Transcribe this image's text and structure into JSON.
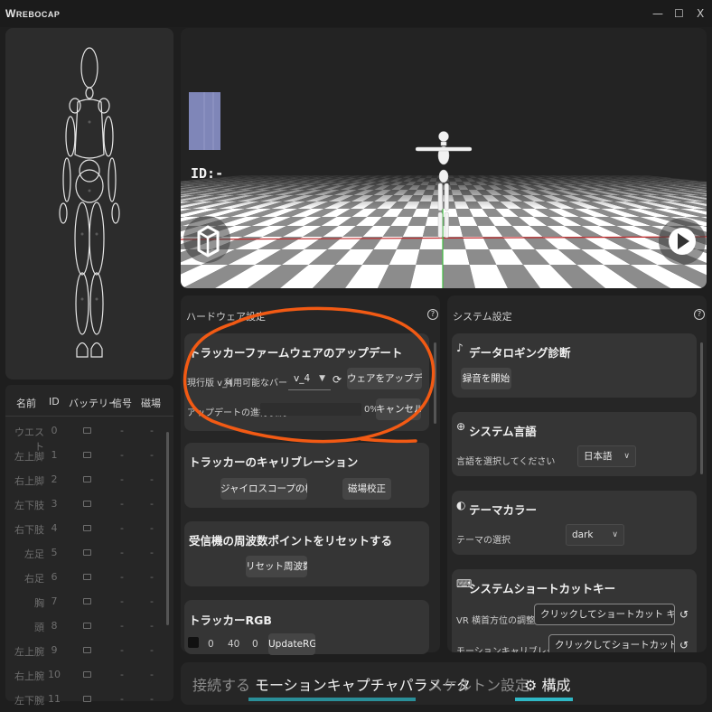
{
  "app": {
    "logo": "REBOCAP",
    "window_controls": {
      "minimize": "—",
      "maximize": "☐",
      "close": "X"
    }
  },
  "viewport": {
    "id_label": "ID:-"
  },
  "tracker_table": {
    "headers": [
      "名前",
      "ID",
      "バッテリー",
      "信号",
      "磁場"
    ],
    "rows": [
      {
        "name": "ウエスト",
        "id": "0",
        "signal": "-",
        "mag": "-"
      },
      {
        "name": "左上脚",
        "id": "1",
        "signal": "-",
        "mag": "-"
      },
      {
        "name": "右上脚",
        "id": "2",
        "signal": "-",
        "mag": "-"
      },
      {
        "name": "左下肢",
        "id": "3",
        "signal": "-",
        "mag": "-"
      },
      {
        "name": "右下肢",
        "id": "4",
        "signal": "-",
        "mag": "-"
      },
      {
        "name": "左足",
        "id": "5",
        "signal": "-",
        "mag": "-"
      },
      {
        "name": "右足",
        "id": "6",
        "signal": "-",
        "mag": "-"
      },
      {
        "name": "胸",
        "id": "7",
        "signal": "-",
        "mag": "-"
      },
      {
        "name": "頭",
        "id": "8",
        "signal": "-",
        "mag": "-"
      },
      {
        "name": "左上腕",
        "id": "9",
        "signal": "-",
        "mag": "-"
      },
      {
        "name": "右上腕",
        "id": "10",
        "signal": "-",
        "mag": "-"
      },
      {
        "name": "左下腕",
        "id": "11",
        "signal": "-",
        "mag": "-"
      }
    ]
  },
  "hardware": {
    "title": "ハードウェア設定",
    "firmware": {
      "title": "トラッカーファームウェアのアップデート",
      "current_label": "現行版 v_4",
      "available_label": "利用可能なバージョン",
      "version": "v_4",
      "update_button": "ウェアをアップデー",
      "progress_label": "アップデートの進行状況",
      "progress_value": "0%",
      "cancel_button": "キャンセル"
    },
    "calibration": {
      "title": "トラッカーのキャリブレーション",
      "gyro_button": "ジャイロスコープの校正",
      "mag_button": "磁場校正"
    },
    "frequency": {
      "title": "受信機の周波数ポイントをリセットする",
      "reset_button": "リセット周波数"
    },
    "rgb": {
      "title": "トラッカーRGB",
      "r": "0",
      "g": "40",
      "b": "0",
      "update_button": "UpdateRGB"
    }
  },
  "system": {
    "title": "システム設定",
    "logging": {
      "title": "データロギング診断",
      "start_button": "録音を開始"
    },
    "language": {
      "title": "システム言語",
      "label": "言語を選択してください",
      "value": "日本語"
    },
    "theme": {
      "title": "テーマカラー",
      "label": "テーマの選択",
      "value": "dark"
    },
    "shortcut": {
      "title": "システムショートカットキー",
      "row1_label": "VR 横首方位の調整",
      "row1_button": "クリックしてショートカット キーを設定します",
      "row2_label": "モーションキャリブレーション",
      "row2_button": "クリックしてショートカット キーを設定し"
    }
  },
  "tabs": {
    "connect": "接続する",
    "motion": "モーションキャプチャパラメータ",
    "skeleton": "スケルトン設定",
    "config": "構成"
  },
  "colors": {
    "accent": "#2fb8c6",
    "annotation": "#f25a14",
    "grid_red_axis": "#c0282a",
    "grid_green_axis": "#3fbf3f"
  }
}
